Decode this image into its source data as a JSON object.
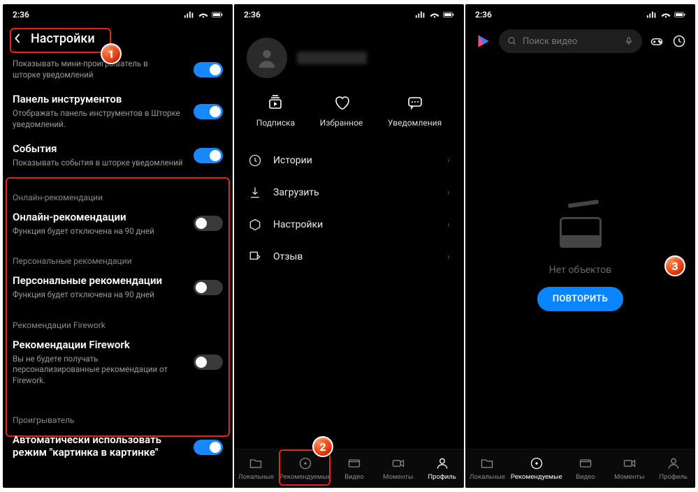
{
  "status": {
    "time": "2:36"
  },
  "s1": {
    "header_title": "Настройки",
    "items": [
      {
        "title": "",
        "desc": "Показывать мини-проигрыватель в шторке уведомлений",
        "on": true,
        "partial": true
      },
      {
        "title": "Панель инструментов",
        "desc": "Отображать панель инструментов в Шторке уведомлений.",
        "on": true
      },
      {
        "title": "События",
        "desc": "Показывать события в шторке уведомлений",
        "on": true
      }
    ],
    "sec1": "Онлайн-рекомендации",
    "rec1": {
      "title": "Онлайн-рекомендации",
      "desc": "Функция будет отключена на 90 дней",
      "on": false
    },
    "sec2": "Персональные рекомендации",
    "rec2": {
      "title": "Персональные рекомендации",
      "desc": "Функция будет отключена на 90 дней",
      "on": false
    },
    "sec3": "Рекомендации Firework",
    "rec3": {
      "title": "Рекомендации Firework",
      "desc": "Вы не будете получать персонализированные рекомендации от Firework.",
      "on": false
    },
    "sec4": "Проигрыватель",
    "last": {
      "title": "Автоматически использовать режим \"картинка в картинке\"",
      "on": true
    }
  },
  "s2": {
    "triple": [
      {
        "label": "Подписка"
      },
      {
        "label": "Избранное"
      },
      {
        "label": "Уведомления"
      }
    ],
    "menu": [
      {
        "label": "Истории"
      },
      {
        "label": "Загрузить"
      },
      {
        "label": "Настройки"
      },
      {
        "label": "Отзыв"
      }
    ],
    "nav": [
      {
        "label": "Локальные"
      },
      {
        "label": "Рекомендуемые"
      },
      {
        "label": "Видео"
      },
      {
        "label": "Моменты"
      },
      {
        "label": "Профиль"
      }
    ]
  },
  "s3": {
    "search_placeholder": "Поиск видео",
    "empty_text": "Нет объектов",
    "retry": "ПОВТОРИТЬ",
    "nav": [
      {
        "label": "Локальные"
      },
      {
        "label": "Рекомендуемые"
      },
      {
        "label": "Видео"
      },
      {
        "label": "Моменты"
      },
      {
        "label": "Профиль"
      }
    ]
  }
}
